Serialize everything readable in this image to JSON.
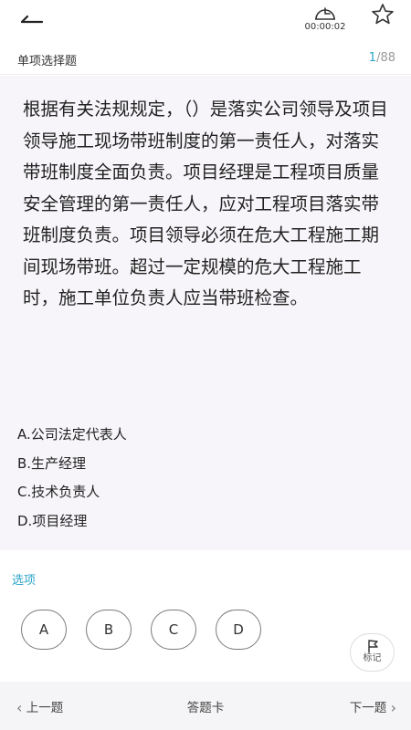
{
  "header": {
    "timer": "00:00:02",
    "icons": {
      "back": "back-arrow-icon",
      "timer": "clock-icon",
      "favorite": "star-icon"
    }
  },
  "question": {
    "type": "单项选择题",
    "current": "1",
    "separator": "/",
    "total": "88",
    "stem": "根据有关法规规定，（）是落实公司领导及项目领导施工现场带班制度的第一责任人，对落实带班制度全面负责。项目经理是工程项目质量安全管理的第一责任人，应对工程项目落实带班制度负责。项目领导必须在危大工程施工期间现场带班。超过一定规模的危大工程施工时，施工单位负责人应当带班检查。",
    "options": [
      {
        "text": "A.公司法定代表人"
      },
      {
        "text": "B.生产经理"
      },
      {
        "text": "C.技术负责人"
      },
      {
        "text": "D.项目经理"
      }
    ]
  },
  "answer": {
    "label": "选项",
    "choices": [
      "A",
      "B",
      "C",
      "D"
    ],
    "mark_label": "标记",
    "accent_color": "#2ba3c9"
  },
  "nav": {
    "prev": "上一题",
    "card": "答题卡",
    "next": "下一题"
  }
}
